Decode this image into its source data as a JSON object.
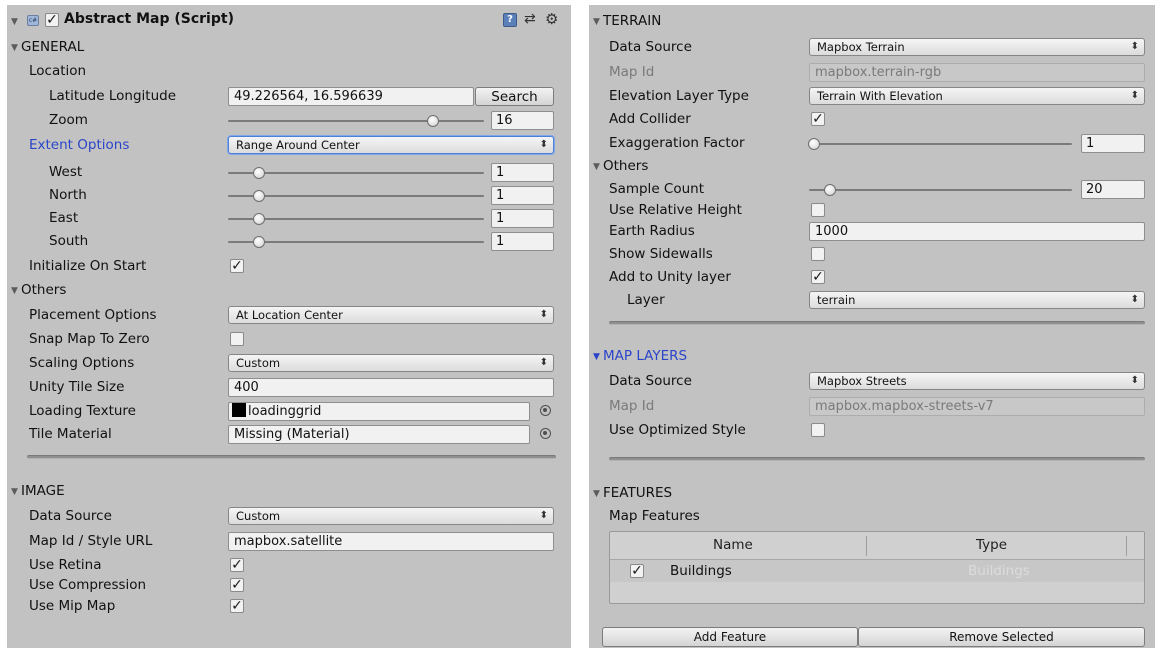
{
  "header": {
    "title": "Abstract Map (Script)",
    "enabled": true
  },
  "left": {
    "general": {
      "label": "GENERAL",
      "location_label": "Location",
      "latlon": {
        "label": "Latitude Longitude",
        "value": "49.226564, 16.596639",
        "search_label": "Search"
      },
      "zoom": {
        "label": "Zoom",
        "value": "16",
        "fraction": 0.8
      },
      "extent": {
        "label": "Extent Options",
        "value": "Range Around Center",
        "west": {
          "label": "West",
          "value": "1",
          "fraction": 0.12
        },
        "north": {
          "label": "North",
          "value": "1",
          "fraction": 0.12
        },
        "east": {
          "label": "East",
          "value": "1",
          "fraction": 0.12
        },
        "south": {
          "label": "South",
          "value": "1",
          "fraction": 0.12
        }
      },
      "init_on_start": {
        "label": "Initialize On Start",
        "checked": true
      }
    },
    "others": {
      "label": "Others",
      "placement": {
        "label": "Placement Options",
        "value": "At Location Center"
      },
      "snap": {
        "label": "Snap Map To Zero",
        "checked": false
      },
      "scaling": {
        "label": "Scaling Options",
        "value": "Custom"
      },
      "tile_size": {
        "label": "Unity Tile Size",
        "value": "400"
      },
      "loading_texture": {
        "label": "Loading Texture",
        "value": "loadinggrid"
      },
      "tile_material": {
        "label": "Tile Material",
        "value": "Missing (Material)"
      }
    },
    "image": {
      "label": "IMAGE",
      "data_source": {
        "label": "Data Source",
        "value": "Custom"
      },
      "map_id": {
        "label": "Map Id / Style URL",
        "value": "mapbox.satellite"
      },
      "retina": {
        "label": "Use Retina",
        "checked": true
      },
      "compression": {
        "label": "Use Compression",
        "checked": true
      },
      "mipmap": {
        "label": "Use Mip Map",
        "checked": true
      }
    }
  },
  "right": {
    "terrain": {
      "label": "TERRAIN",
      "data_source": {
        "label": "Data Source",
        "value": "Mapbox Terrain"
      },
      "map_id": {
        "label": "Map Id",
        "value": "mapbox.terrain-rgb"
      },
      "elevation": {
        "label": "Elevation Layer Type",
        "value": "Terrain With Elevation"
      },
      "collider": {
        "label": "Add Collider",
        "checked": true
      },
      "exaggeration": {
        "label": "Exaggeration Factor",
        "value": "1",
        "fraction": 0.02
      }
    },
    "others": {
      "label": "Others",
      "sample_count": {
        "label": "Sample Count",
        "value": "20",
        "fraction": 0.08
      },
      "relative_height": {
        "label": "Use Relative Height",
        "checked": false
      },
      "earth_radius": {
        "label": "Earth Radius",
        "value": "1000"
      },
      "sidewalls": {
        "label": "Show Sidewalls",
        "checked": false
      },
      "unity_layer": {
        "label": "Add to Unity layer",
        "checked": true
      },
      "layer": {
        "label": "Layer",
        "value": "terrain"
      }
    },
    "map_layers": {
      "label": "MAP LAYERS",
      "data_source": {
        "label": "Data Source",
        "value": "Mapbox Streets"
      },
      "map_id": {
        "label": "Map Id",
        "value": "mapbox.mapbox-streets-v7"
      },
      "optimized": {
        "label": "Use Optimized Style",
        "checked": false
      }
    },
    "features": {
      "label": "FEATURES",
      "map_features_label": "Map Features",
      "columns": [
        "Name",
        "Type"
      ],
      "rows": [
        {
          "checked": true,
          "name": "Buildings",
          "type": "Buildings"
        }
      ],
      "add_label": "Add Feature",
      "remove_label": "Remove Selected"
    }
  },
  "icons": {
    "foldout": "triangle-down",
    "check": "check-mark",
    "dropdown": "up-down-arrows"
  }
}
